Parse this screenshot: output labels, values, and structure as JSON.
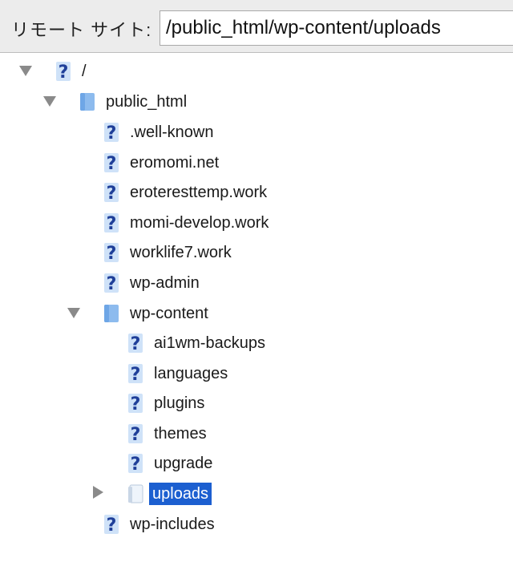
{
  "path_bar": {
    "label": "リモート サイト:",
    "value": "/public_html/wp-content/uploads"
  },
  "tree": {
    "root": {
      "label": "/",
      "expanded": true,
      "icon": "unknown-folder-icon"
    },
    "public_html": {
      "label": "public_html",
      "expanded": true,
      "icon": "folder-icon"
    },
    "well_known": {
      "label": ".well-known",
      "icon": "unknown-folder-icon"
    },
    "eromomi": {
      "label": "eromomi.net",
      "icon": "unknown-folder-icon"
    },
    "eroteresttemp": {
      "label": "eroteresttemp.work",
      "icon": "unknown-folder-icon"
    },
    "momi_develop": {
      "label": "momi-develop.work",
      "icon": "unknown-folder-icon"
    },
    "worklife7": {
      "label": "worklife7.work",
      "icon": "unknown-folder-icon"
    },
    "wp_admin": {
      "label": "wp-admin",
      "icon": "unknown-folder-icon"
    },
    "wp_content": {
      "label": "wp-content",
      "expanded": true,
      "icon": "folder-icon"
    },
    "ai1wm_backups": {
      "label": "ai1wm-backups",
      "icon": "unknown-folder-icon"
    },
    "languages": {
      "label": "languages",
      "icon": "unknown-folder-icon"
    },
    "plugins": {
      "label": "plugins",
      "icon": "unknown-folder-icon"
    },
    "themes": {
      "label": "themes",
      "icon": "unknown-folder-icon"
    },
    "upgrade": {
      "label": "upgrade",
      "icon": "unknown-folder-icon"
    },
    "uploads": {
      "label": "uploads",
      "expanded": false,
      "selected": true,
      "icon": "open-folder-icon"
    },
    "wp_includes": {
      "label": "wp-includes",
      "icon": "unknown-folder-icon"
    }
  },
  "colors": {
    "selection": "#1c5fd0",
    "folder": "#6ea6e6",
    "question_mark": "#1f3f99"
  }
}
